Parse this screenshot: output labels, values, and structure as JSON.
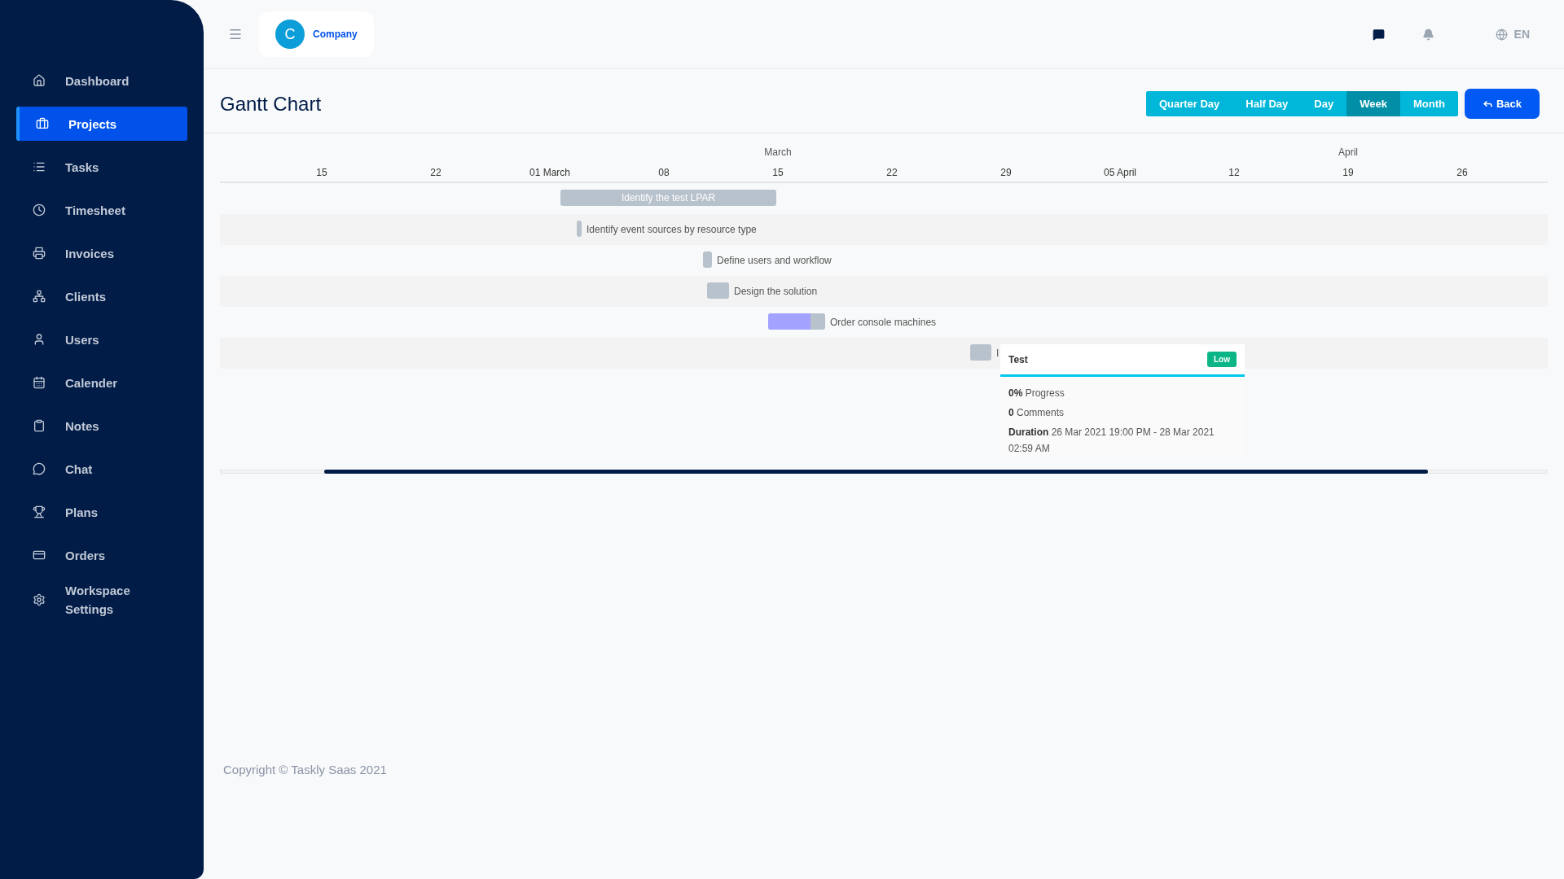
{
  "sidebar": {
    "items": [
      {
        "label": "Dashboard",
        "selected": false
      },
      {
        "label": "Projects",
        "selected": true
      },
      {
        "label": "Tasks",
        "selected": false
      },
      {
        "label": "Timesheet",
        "selected": false
      },
      {
        "label": "Invoices",
        "selected": false
      },
      {
        "label": "Clients",
        "selected": false
      },
      {
        "label": "Users",
        "selected": false
      },
      {
        "label": "Calender",
        "selected": false
      },
      {
        "label": "Notes",
        "selected": false
      },
      {
        "label": "Chat",
        "selected": false
      },
      {
        "label": "Plans",
        "selected": false
      },
      {
        "label": "Orders",
        "selected": false
      },
      {
        "label": "Workspace Settings",
        "selected": false
      }
    ]
  },
  "header": {
    "workspace": {
      "initial": "C",
      "name": "Company"
    },
    "language": "EN"
  },
  "page": {
    "title": "Gantt Chart",
    "view_modes": [
      {
        "label": "Quarter Day",
        "selected": false
      },
      {
        "label": "Half Day",
        "selected": false
      },
      {
        "label": "Day",
        "selected": false
      },
      {
        "label": "Week",
        "selected": true
      },
      {
        "label": "Month",
        "selected": false
      }
    ],
    "back_button": "Back"
  },
  "gantt": {
    "months": [
      "March",
      "April"
    ],
    "weeks": [
      "15",
      "22",
      "01 March",
      "08",
      "15",
      "22",
      "29",
      "05 April",
      "12",
      "19",
      "26"
    ],
    "tasks": [
      {
        "name": "Identify the test LPAR"
      },
      {
        "name": "Identify event sources by resource type"
      },
      {
        "name": "Define users and workflow"
      },
      {
        "name": "Design the solution"
      },
      {
        "name": "Order console machines",
        "level": 0.74
      },
      {
        "name": "I"
      }
    ],
    "popup": {
      "title": "Test",
      "priority": "Low",
      "lines": [
        "**0%** Progress",
        "**0** Comments",
        "**Duration** 26 Mar 2021 19:00 PM - 28 Mar 2021 02:59 AM"
      ]
    }
  },
  "footer": {
    "copyright": "Copyright © Taskly Saas 2021"
  }
}
